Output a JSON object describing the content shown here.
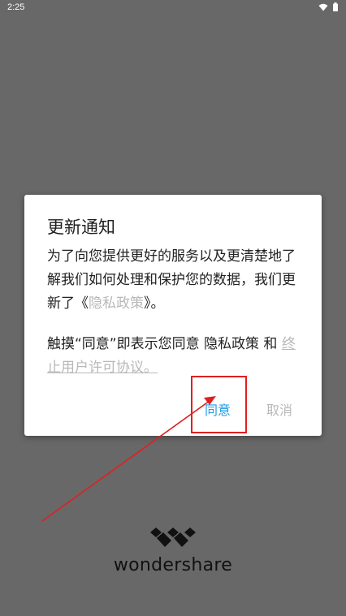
{
  "status_bar": {
    "time": "2:25",
    "wifi_icon": "wifi-icon",
    "battery_icon": "battery-icon"
  },
  "dialog": {
    "title": "更新通知",
    "body_prefix": "为了向您提供更好的服务以及更清楚地了解我们如何处理和保护您的数据，我们更新了《",
    "policy_link": "隐私政策",
    "body_suffix": "》。",
    "consent_prefix": "触摸“同意”即表示您同意 隐私政策 和 ",
    "terms_link": "终止用户许可协议。",
    "agree_label": "同意",
    "cancel_label": "取消"
  },
  "brand": {
    "name": "wondershare",
    "logo_icon": "wondershare-logo-icon"
  },
  "colors": {
    "backdrop": "#686868",
    "accent": "#1e9be6",
    "muted": "#b8b8b8",
    "annotation": "#e02020"
  }
}
